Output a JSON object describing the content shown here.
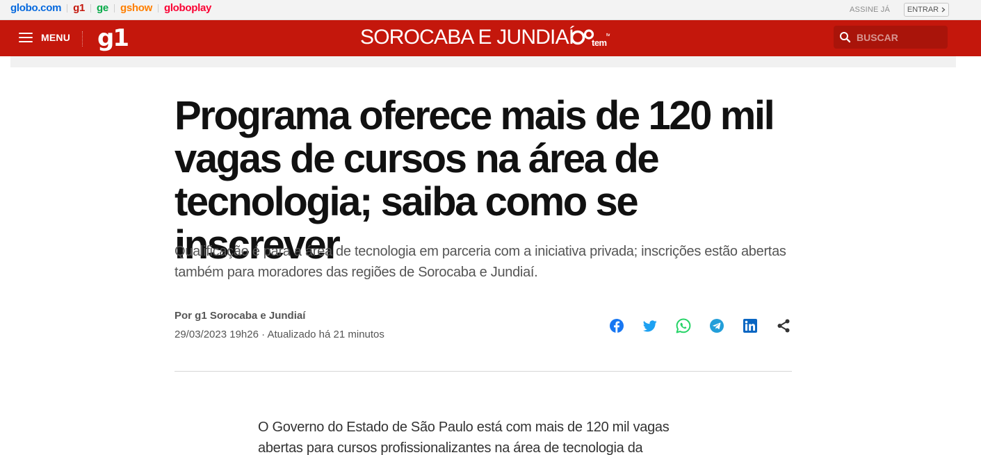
{
  "globo_bar": {
    "links": [
      "globo.com",
      "g1",
      "ge",
      "gshow",
      "globoplay"
    ],
    "assine": "ASSINE JÁ",
    "entrar": "ENTRAR",
    "entrar_icon": "chevron-right-icon"
  },
  "header": {
    "menu_label": "MENU",
    "logo": "g1",
    "region": "SOROCABA E JUNDIAÍ",
    "affiliate_logo": "tem",
    "search_placeholder": "BUSCAR",
    "colors": {
      "header_bg": "#c4170c",
      "search_bg": "#a9140a"
    }
  },
  "article": {
    "title": "Programa oferece mais de 120 mil vagas de cursos na área de tecnologia; saiba como se inscrever",
    "subtitle": "Qualificação é para a área de tecnologia em parceria com a iniciativa privada; inscrições estão abertas também para moradores das regiões de Sorocaba e Jundiaí.",
    "byline": "Por g1 Sorocaba e Jundiaí",
    "dateline": "29/03/2023 19h26 · Atualizado há 21 minutos",
    "share": [
      "facebook-icon",
      "twitter-icon",
      "whatsapp-icon",
      "telegram-icon",
      "linkedin-icon",
      "share-icon"
    ],
    "body_first": "O Governo do Estado de São Paulo está com mais de 120 mil vagas abertas para cursos profissionalizantes na área de tecnologia da"
  }
}
